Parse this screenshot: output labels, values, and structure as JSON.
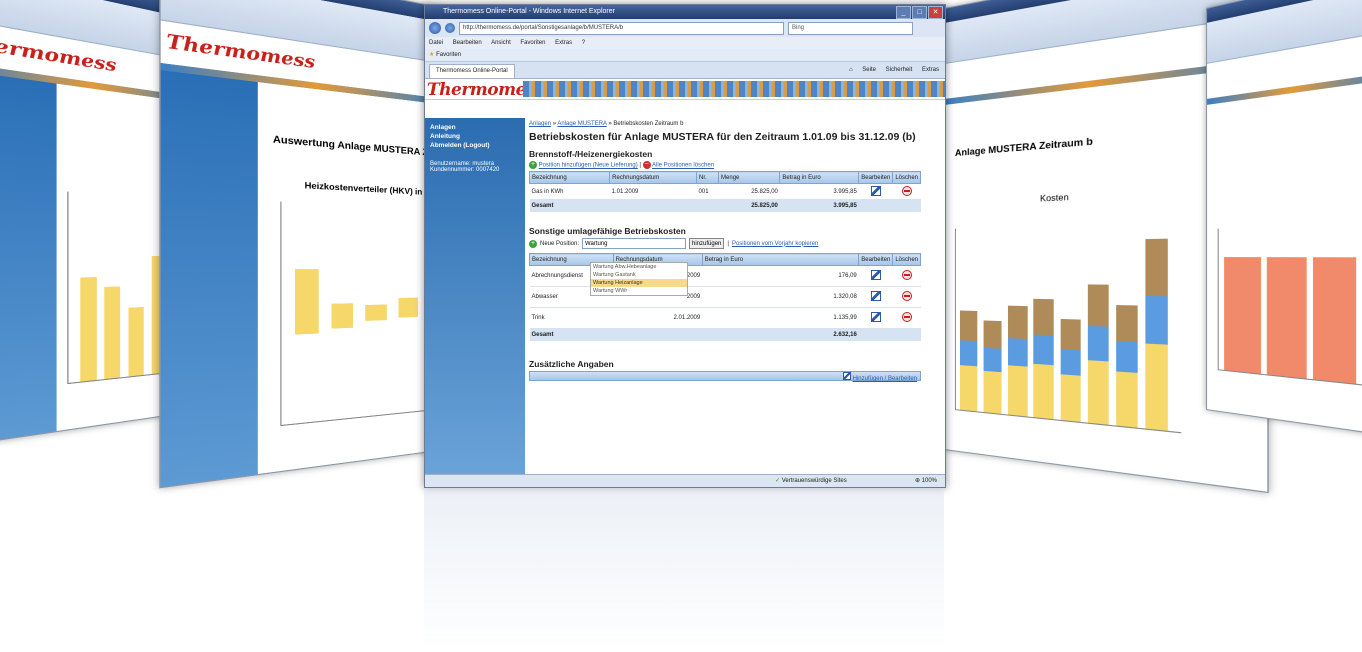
{
  "window": {
    "title": "Thermomess Online-Portal - Windows Internet Explorer",
    "url": "http://thermomess.de/portal/Sonstigesanlage/b/MUSTERA/b",
    "search_placeholder": "Bing",
    "menu": [
      "Datei",
      "Bearbeiten",
      "Ansicht",
      "Favoriten",
      "Extras",
      "?"
    ],
    "favorites_label": "Favoriten",
    "tab_label": "Thermomess Online-Portal",
    "tools": [
      "Seite",
      "Sicherheit",
      "Extras"
    ]
  },
  "brand": "Thermomess",
  "sidebar": {
    "items": [
      "Anlagen",
      "Anleitung",
      "Abmelden (Logout)"
    ],
    "user_label": "Benutzername: mustera",
    "customer_label": "Kundennummer: 0007420"
  },
  "breadcrumb": {
    "items": [
      "Anlagen",
      "Anlage MUSTERA",
      "Betriebskosten Zeitraum b"
    ]
  },
  "page_title": "Betriebskosten für Anlage MUSTERA für den Zeitraum 1.01.09 bis 31.12.09 (b)",
  "fuel": {
    "title": "Brennstoff-/Heizenergiekosten",
    "add_link": "Position hinzufügen (Neue Lieferung)",
    "delete_all_link": "Alle Positionen löschen",
    "headers": [
      "Bezeichnung",
      "Rechnungsdatum",
      "Nr.",
      "Menge",
      "Betrag in Euro",
      "Bearbeiten",
      "Löschen"
    ],
    "rows": [
      {
        "name": "Gas in KWh",
        "date": "1.01.2009",
        "nr": "001",
        "menge": "25.825,00",
        "betrag": "3.995,85"
      }
    ],
    "total_label": "Gesamt",
    "total_menge": "25.825,00",
    "total_betrag": "3.995,85"
  },
  "other": {
    "title": "Sonstige umlagefähige Betriebskosten",
    "new_position_label": "Neue Position:",
    "new_position_value": "Wartung",
    "add_button": "hinzufügen",
    "copy_link": "Positionen vom Vorjahr kopieren",
    "headers": [
      "Bezeichnung",
      "Rechnungsdatum",
      "Betrag in Euro",
      "Bearbeiten",
      "Löschen"
    ],
    "rows": [
      {
        "name": "Abrechnungsdienst",
        "date": "1.2009",
        "betrag": "176,09"
      },
      {
        "name": "Abwasser",
        "date": "2009",
        "betrag": "1.320,08"
      },
      {
        "name": "Trink",
        "date": "2.01.2009",
        "betrag": "1.135,99"
      }
    ],
    "total_label": "Gesamt",
    "total_betrag": "2.632,16",
    "suggestions": [
      "Wartung Abw.Hebeanlage",
      "Wartung Gastank",
      "Wartung Heizanlage",
      "Wartung WWr"
    ]
  },
  "extra": {
    "title": "Zusätzliche Angaben",
    "link": "Hinzufügen / Bearbeiten"
  },
  "status": {
    "trust": "Vertrauenswürdige Sites",
    "zoom": "100%"
  },
  "side_windows": {
    "left_title": "Auswertung Anlage MUSTERA Zeitraum",
    "left_chart_title": "Heizkostenverteiler (HKV) in VE Abrechnung",
    "right_title": "Anlage MUSTERA Zeitraum b",
    "right_chart_title": "Kosten"
  },
  "colors": {
    "brand_red": "#c8201a",
    "sidebar_blue": "#2b6cb0",
    "bar_yellow": "#f5d76a",
    "bar_blue": "#5b9be0",
    "bar_brown": "#b08b5a",
    "bar_salmon": "#f08a6a"
  }
}
